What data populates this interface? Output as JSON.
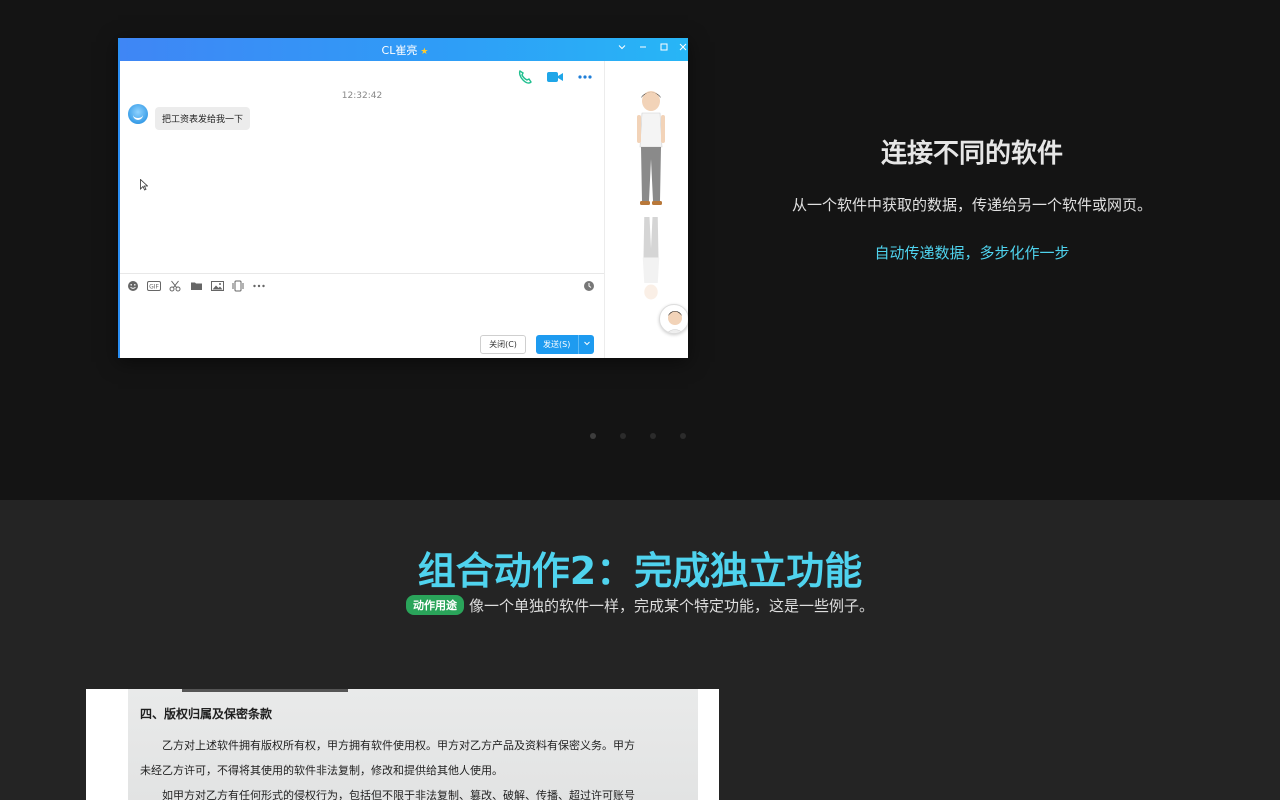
{
  "chat": {
    "title": "CL崔亮",
    "title_star": "★",
    "timestamp": "12:32:42",
    "message": "把工资表发给我一下",
    "close_button": "关闭(C)",
    "send_button": "发送(S)"
  },
  "feature": {
    "title": "连接不同的软件",
    "description": "从一个软件中获取的数据，传递给另一个软件或网页。",
    "highlight": "自动传递数据，多步化作一步"
  },
  "section": {
    "title": "组合动作2：完成独立功能",
    "tag": "动作用途",
    "subtitle": "像一个单独的软件一样，完成某个特定功能，这是一些例子。"
  },
  "document": {
    "heading": "四、版权归属及保密条款",
    "line1": "乙方对上述软件拥有版权所有权，甲方拥有软件使用权。甲方对乙方产品及资料有保密义务。甲方",
    "line2": "未经乙方许可，不得将其使用的软件非法复制，修改和提供给其他人使用。",
    "line3": "如甲方对乙方有任何形式的侵权行为，包括但不限于非法复制、篡改、破解、传播、超过许可账号"
  },
  "colors": {
    "accent": "#4fd3ee",
    "tag_green": "#2aa45a",
    "send_blue": "#1e9bf0",
    "titlebar_blue": "#3f86f5"
  }
}
